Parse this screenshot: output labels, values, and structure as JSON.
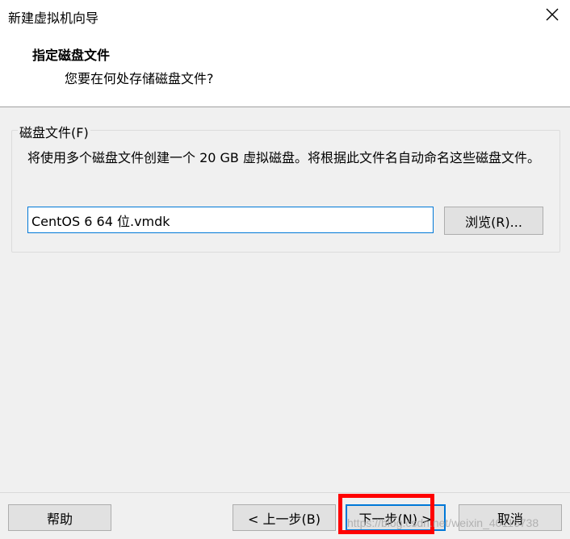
{
  "window": {
    "title": "新建虚拟机向导",
    "close_icon": "close-icon"
  },
  "header": {
    "heading": "指定磁盘文件",
    "subheading": "您要在何处存储磁盘文件?"
  },
  "disk_file_group": {
    "legend": "磁盘文件(F)",
    "description": "将使用多个磁盘文件创建一个 20 GB 虚拟磁盘。将根据此文件名自动命名这些磁盘文件。",
    "file_name_value": "CentOS 6 64 位.vmdk",
    "browse_label": "浏览(R)..."
  },
  "footer": {
    "help_label": "帮助",
    "back_label": "< 上一步(B)",
    "next_label": "下一步(N) >",
    "cancel_label": "取消"
  },
  "annotation": {
    "highlight_color": "#ff0000",
    "watermark_text": "https://blog.csdn.net/weixin_40116738"
  }
}
